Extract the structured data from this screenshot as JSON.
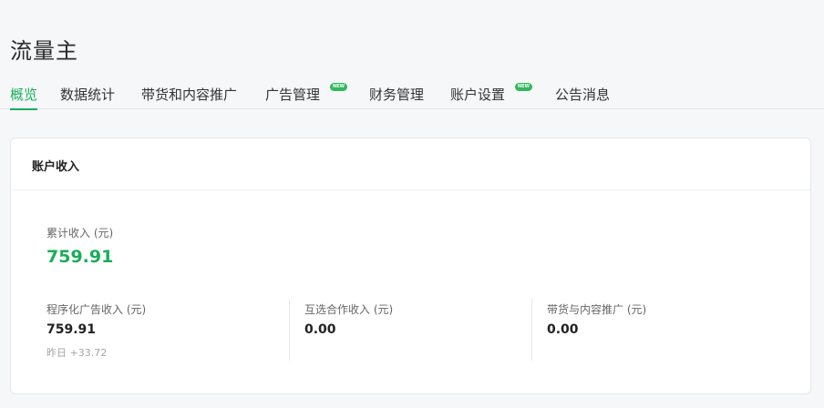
{
  "app_title": "流量主",
  "tabs": [
    {
      "label": "概览",
      "active": true,
      "badge": ""
    },
    {
      "label": "数据统计",
      "active": false,
      "badge": ""
    },
    {
      "label": "带货和内容推广",
      "active": false,
      "badge": ""
    },
    {
      "label": "广告管理",
      "active": false,
      "badge": "NEW"
    },
    {
      "label": "财务管理",
      "active": false,
      "badge": ""
    },
    {
      "label": "账户设置",
      "active": false,
      "badge": "NEW"
    },
    {
      "label": "公告消息",
      "active": false,
      "badge": ""
    }
  ],
  "account_income": {
    "title": "账户收入",
    "total": {
      "label": "累计收入 (元)",
      "value": "759.91"
    },
    "breakdown": [
      {
        "label": "程序化广告收入 (元)",
        "value": "759.91",
        "note": "昨日 +33.72"
      },
      {
        "label": "互选合作收入 (元)",
        "value": "0.00"
      },
      {
        "label": "带货与内容推广 (元)",
        "value": "0.00"
      }
    ]
  },
  "colors": {
    "accent": "#1aad5a",
    "badge": "#32b85c",
    "background": "#f6f7f9"
  }
}
